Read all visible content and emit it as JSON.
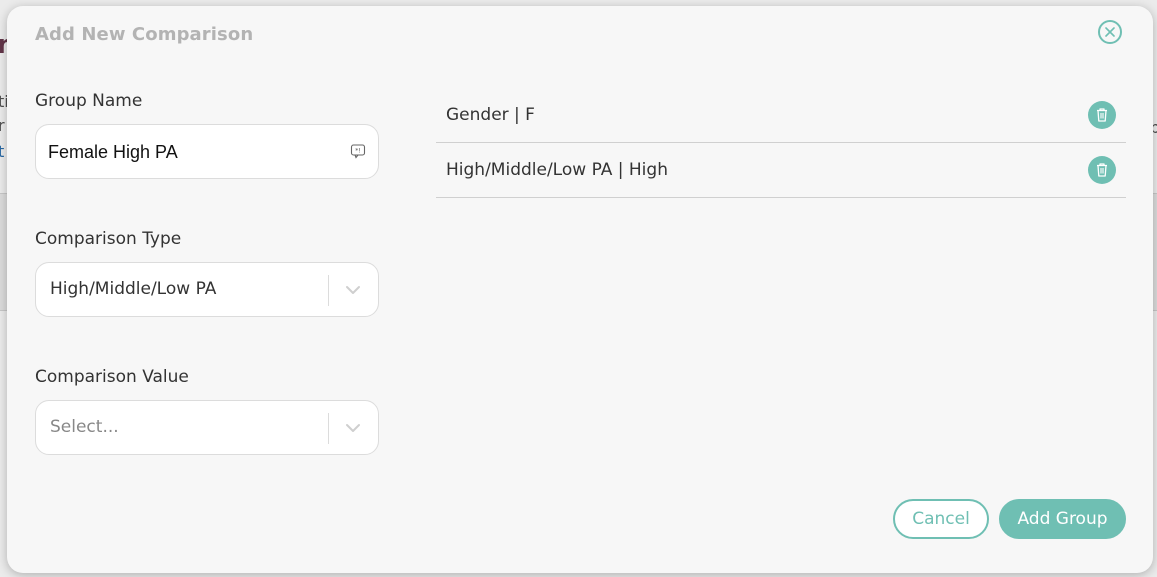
{
  "background": {
    "fragments": [
      "n",
      "ti",
      "r",
      "t",
      "p"
    ]
  },
  "modal": {
    "title": "Add New Comparison",
    "group_name": {
      "label": "Group Name",
      "value": "Female High PA"
    },
    "comparison_type": {
      "label": "Comparison Type",
      "selected": "High/Middle/Low PA"
    },
    "comparison_value": {
      "label": "Comparison Value",
      "placeholder": "Select..."
    },
    "groups": [
      {
        "label": "Gender | F"
      },
      {
        "label": "High/Middle/Low PA | High"
      }
    ],
    "buttons": {
      "cancel": "Cancel",
      "add_group": "Add Group"
    }
  },
  "colors": {
    "accent": "#6fbfb3",
    "title": "#b3b3b3",
    "modal_bg": "#f7f7f7"
  },
  "icons": {
    "close": "close-icon",
    "input_helper": "keyboard-icon",
    "dropdown": "chevron-down-icon",
    "delete": "trash-icon"
  }
}
